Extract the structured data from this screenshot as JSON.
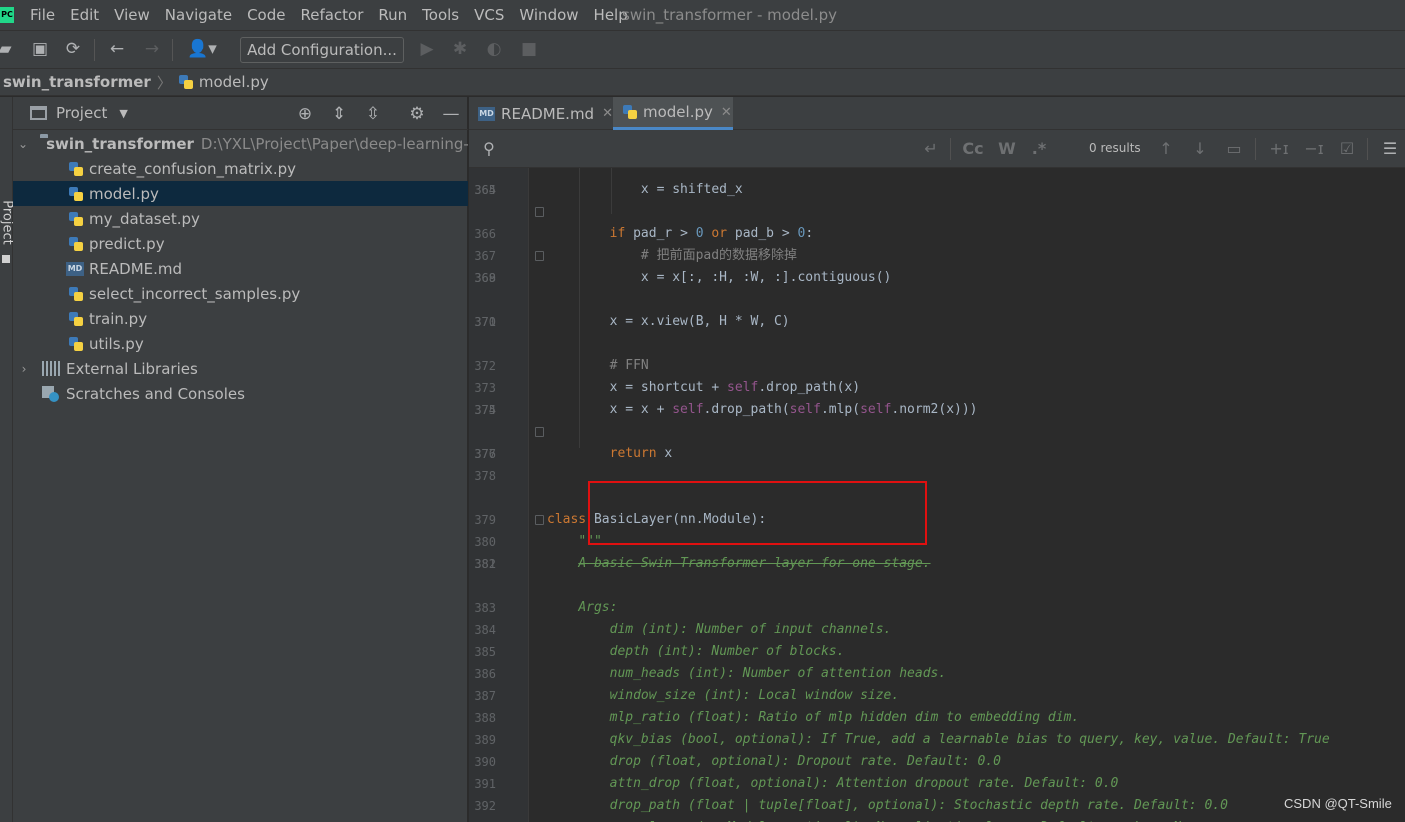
{
  "app": {
    "logo_text": "PC",
    "window_title": "swin_transformer - model.py",
    "menu": [
      "File",
      "Edit",
      "View",
      "Navigate",
      "Code",
      "Refactor",
      "Run",
      "Tools",
      "VCS",
      "Window",
      "Help"
    ]
  },
  "toolbar": {
    "add_configuration_label": "Add Configuration..."
  },
  "breadcrumb": {
    "project": "swin_transformer",
    "file": "model.py"
  },
  "project_panel": {
    "strip_label": "Project",
    "title": "Project",
    "root": {
      "name": "swin_transformer",
      "path": "D:\\YXL\\Project\\Paper\\deep-learning-for-"
    },
    "files": [
      {
        "name": "create_confusion_matrix.py",
        "type": "python"
      },
      {
        "name": "model.py",
        "type": "python",
        "selected": true
      },
      {
        "name": "my_dataset.py",
        "type": "python"
      },
      {
        "name": "predict.py",
        "type": "python"
      },
      {
        "name": "README.md",
        "type": "markdown"
      },
      {
        "name": "select_incorrect_samples.py",
        "type": "python"
      },
      {
        "name": "train.py",
        "type": "python"
      },
      {
        "name": "utils.py",
        "type": "python"
      }
    ],
    "external_libraries": "External Libraries",
    "scratches": "Scratches and Consoles"
  },
  "editor": {
    "tabs": [
      {
        "label": "README.md",
        "icon": "md-icon",
        "active": false
      },
      {
        "label": "model.py",
        "icon": "python-file-icon",
        "active": true
      }
    ],
    "find": {
      "results": "0 results",
      "case_label": "Cc",
      "word_label": "W",
      "regex_label": ".*"
    }
  },
  "watermark": "CSDN @QT-Smile",
  "colors": {
    "keyword": "#cc7832",
    "self": "#94558d",
    "number": "#6897bb",
    "comment": "#808080",
    "docstring": "#629755",
    "highlight_box": "#e01010",
    "selection": "#0d293e"
  }
}
